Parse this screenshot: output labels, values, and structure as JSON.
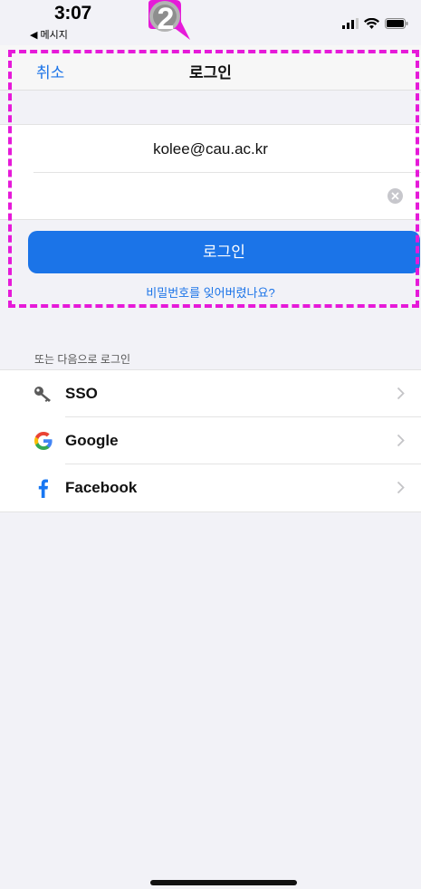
{
  "status_bar": {
    "time": "3:07",
    "back_app": "◀ 메시지"
  },
  "annotation": {
    "step_number": "2",
    "highlight_color": "#e61ad9"
  },
  "nav": {
    "cancel_label": "취소",
    "title": "로그인"
  },
  "form": {
    "email_value": "kolee@cau.ac.kr",
    "password_value": ""
  },
  "actions": {
    "login_label": "로그인",
    "forgot_password": "비밀번호를 잊어버렸나요?",
    "accent_color": "#1b74e8"
  },
  "alternatives": {
    "header": "또는 다음으로 로그인",
    "items": [
      {
        "label": "SSO",
        "icon": "key-icon"
      },
      {
        "label": "Google",
        "icon": "google-icon"
      },
      {
        "label": "Facebook",
        "icon": "facebook-icon"
      }
    ]
  }
}
